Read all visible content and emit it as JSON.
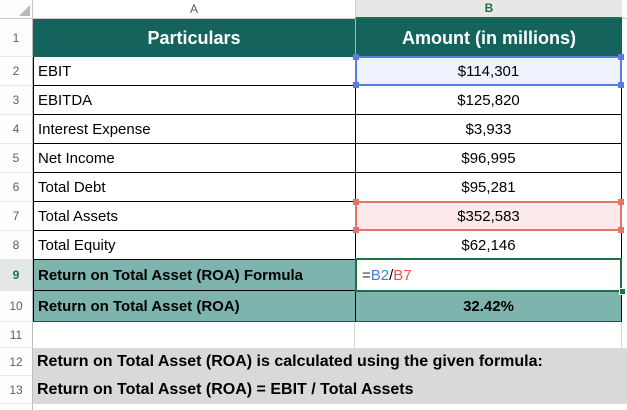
{
  "columns": {
    "a": "A",
    "b": "B"
  },
  "row_numbers": [
    "1",
    "2",
    "3",
    "4",
    "5",
    "6",
    "7",
    "8",
    "9",
    "10",
    "11",
    "12",
    "13"
  ],
  "table": {
    "header": {
      "particulars": "Particulars",
      "amount": "Amount (in millions)"
    },
    "rows": [
      {
        "label": "EBIT",
        "value": "$114,301"
      },
      {
        "label": "EBITDA",
        "value": "$125,820"
      },
      {
        "label": "Interest Expense",
        "value": "$3,933"
      },
      {
        "label": "Net Income",
        "value": "$96,995"
      },
      {
        "label": "Total Debt",
        "value": "$95,281"
      },
      {
        "label": "Total Assets",
        "value": "$352,583"
      },
      {
        "label": "Total Equity",
        "value": "$62,146"
      }
    ],
    "formula_row": {
      "label": "Return on Total Asset (ROA) Formula",
      "formula": {
        "eq": "=",
        "ref1": "B2",
        "op": "/",
        "ref2": "B7"
      }
    },
    "result_row": {
      "label": "Return on Total Asset (ROA)",
      "value": "32.42%"
    }
  },
  "notes": [
    "Return on Total Asset (ROA) is calculated using the given formula:",
    "Return on Total Asset (ROA) = EBIT / Total Assets"
  ],
  "colors": {
    "header_teal": "#15635D",
    "band_teal": "#7DB4AD",
    "note_gray": "#D9D9D9",
    "reference_blue": "#5A7CE2",
    "reference_red": "#E5736A",
    "edit_border_green": "#1E7145",
    "formula_ref1_color": "#4D7BE5",
    "formula_ref2_color": "#E8544C"
  }
}
